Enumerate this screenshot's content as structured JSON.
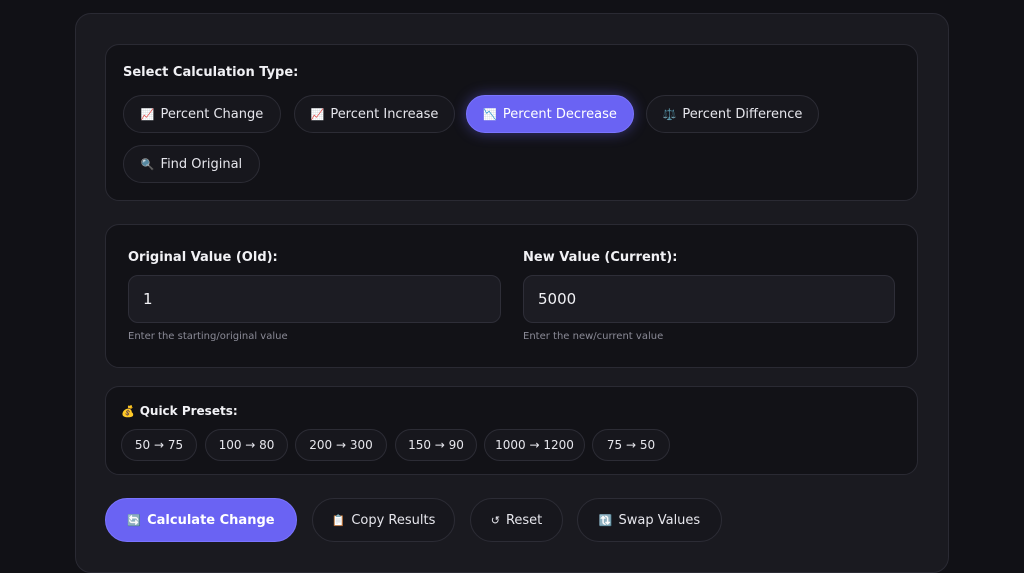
{
  "calc_type": {
    "title": "Select Calculation Type:",
    "options": [
      {
        "icon": "chart-up-icon",
        "glyph": "📈",
        "label": "Percent Change",
        "active": false
      },
      {
        "icon": "chart-up-icon",
        "glyph": "📈",
        "label": "Percent Increase",
        "active": false
      },
      {
        "icon": "chart-down-icon",
        "glyph": "📉",
        "label": "Percent Decrease",
        "active": true
      },
      {
        "icon": "scales-icon",
        "glyph": "⚖️",
        "label": "Percent Difference",
        "active": false
      },
      {
        "icon": "magnifier-icon",
        "glyph": "🔍",
        "label": "Find Original",
        "active": false
      }
    ]
  },
  "values": {
    "original": {
      "label": "Original Value (Old):",
      "value": "1",
      "hint": "Enter the starting/original value"
    },
    "new": {
      "label": "New Value (Current):",
      "value": "5000",
      "hint": "Enter the new/current value"
    }
  },
  "presets": {
    "icon": "money-bag-icon",
    "glyph": "💰",
    "title": "Quick Presets:",
    "items": [
      "50 → 75",
      "100 → 80",
      "200 → 300",
      "150 → 90",
      "1000 → 1200",
      "75 → 50"
    ]
  },
  "actions": {
    "calculate": {
      "icon": "refresh-icon",
      "glyph": "🔄",
      "label": "Calculate Change"
    },
    "copy": {
      "icon": "clipboard-icon",
      "glyph": "📋",
      "label": "Copy Results"
    },
    "reset": {
      "icon": "reset-icon",
      "glyph": "↺",
      "label": "Reset"
    },
    "swap": {
      "icon": "swap-icon",
      "glyph": "🔃",
      "label": "Swap Values"
    }
  },
  "colors": {
    "accent": "#6a63f3",
    "background": "#111116",
    "card": "#121217"
  }
}
